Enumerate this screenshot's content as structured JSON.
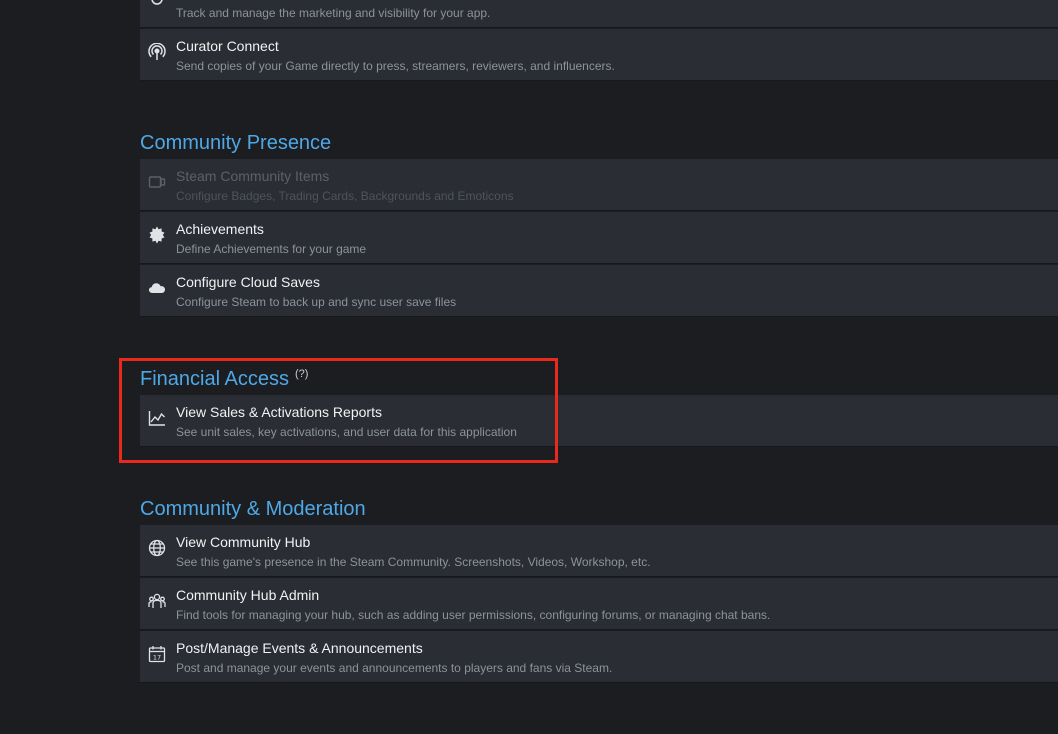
{
  "sections": {
    "marketing": {
      "items": [
        {
          "title": "",
          "desc": "Track and manage the marketing and visibility for your app.",
          "icon": "megaphone-icon"
        },
        {
          "title": "Curator Connect",
          "desc": "Send copies of your Game directly to press, streamers, reviewers, and influencers.",
          "icon": "broadcast-icon"
        }
      ]
    },
    "community_presence": {
      "title": "Community Presence",
      "items": [
        {
          "title": "Steam Community Items",
          "desc": "Configure Badges, Trading Cards, Backgrounds and Emoticons",
          "icon": "card-icon",
          "disabled": true
        },
        {
          "title": "Achievements",
          "desc": "Define Achievements for your game",
          "icon": "badge-icon"
        },
        {
          "title": "Configure Cloud Saves",
          "desc": "Configure Steam to back up and sync user save files",
          "icon": "cloud-icon"
        }
      ]
    },
    "financial_access": {
      "title": "Financial Access",
      "help": "(?)",
      "items": [
        {
          "title": "View Sales & Activations Reports",
          "desc": "See unit sales, key activations, and user data for this application",
          "icon": "line-chart-icon"
        }
      ]
    },
    "community_moderation": {
      "title": "Community & Moderation",
      "items": [
        {
          "title": "View Community Hub",
          "desc": "See this game's presence in the Steam Community. Screenshots, Videos, Workshop, etc.",
          "icon": "globe-icon"
        },
        {
          "title": "Community Hub Admin",
          "desc": "Find tools for managing your hub, such as adding user permissions, configuring forums, or managing chat bans.",
          "icon": "users-icon"
        },
        {
          "title": "Post/Manage Events & Announcements",
          "desc": "Post and manage your events and announcements to players and fans via Steam.",
          "icon": "calendar-icon"
        }
      ]
    }
  },
  "colors": {
    "background": "#1b1d21",
    "item_background": "#2a2d33",
    "section_title": "#4fa8e6",
    "highlight": "#e8291c"
  }
}
